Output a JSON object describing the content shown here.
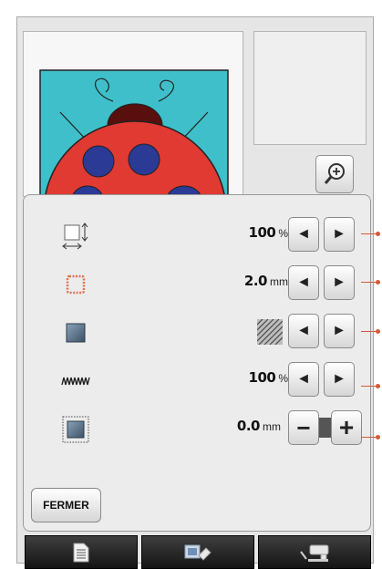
{
  "colors": {
    "accent_red": "#e03a33",
    "spot_blue": "#2a3a95",
    "teal_background": "#3fbfc9",
    "pointer_line": "#d35a3a"
  },
  "toolbar": {
    "zoom_icon": "magnifier-plus-icon"
  },
  "settings": [
    {
      "icon": "resize-icon",
      "value": "100",
      "unit": "%",
      "control": "arrows"
    },
    {
      "icon": "outline-width-icon",
      "value": "2.0",
      "unit": "mm",
      "control": "arrows"
    },
    {
      "icon": "fill-pattern-icon",
      "value": "",
      "unit": "",
      "control": "arrows",
      "preview": "hatch-pattern"
    },
    {
      "icon": "stitch-density-icon",
      "value": "100",
      "unit": "%",
      "control": "arrows"
    },
    {
      "icon": "offset-outline-icon",
      "value": "0.0",
      "unit": "mm",
      "control": "plus-minus"
    }
  ],
  "buttons": {
    "close_label": "FERMER",
    "decrease_symbol": "◄",
    "increase_symbol": "►",
    "minus_symbol": "−",
    "plus_symbol": "+"
  },
  "bottom_tabs": [
    {
      "icon": "document-icon"
    },
    {
      "icon": "eraser-icon"
    },
    {
      "icon": "sewing-machine-icon"
    }
  ]
}
